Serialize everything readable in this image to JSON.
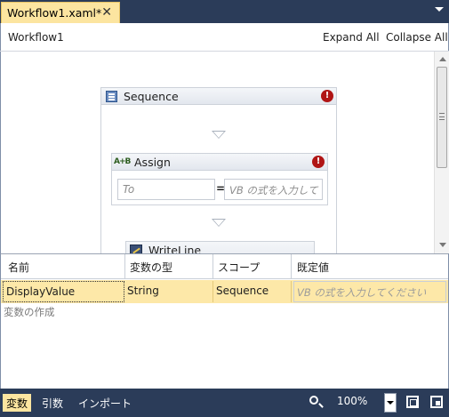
{
  "tab": {
    "title": "Workflow1.xaml*",
    "close": "✕"
  },
  "header": {
    "breadcrumb": "Workflow1",
    "expand_all": "Expand All",
    "collapse_all": "Collapse All"
  },
  "designer": {
    "sequence": {
      "label": "Sequence",
      "error": "!"
    },
    "assign": {
      "label": "Assign",
      "icon_text": "A+B",
      "error": "!",
      "to_placeholder": "To",
      "equals": "=",
      "value_placeholder": "VB の式を入力して"
    },
    "writeline": {
      "label": "WriteLine"
    }
  },
  "variables": {
    "columns": [
      "名前",
      "変数の型",
      "スコープ",
      "既定値"
    ],
    "rows": [
      {
        "name": "DisplayValue",
        "type": "String",
        "scope": "Sequence",
        "default_placeholder": "VB の式を入力してください"
      }
    ],
    "create_label": "変数の作成"
  },
  "bottombar": {
    "tabs": [
      "変数",
      "引数",
      "インポート"
    ],
    "zoom": "100%"
  },
  "colors": {
    "chrome": "#2b3c59",
    "active_tab": "#fce5a0",
    "selected_row": "#fde8a8",
    "error": "#b01515"
  }
}
